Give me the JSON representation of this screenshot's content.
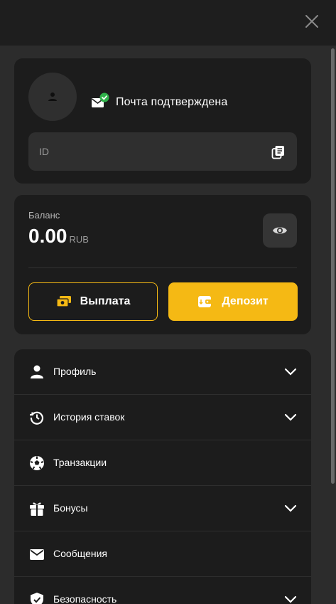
{
  "header": {
    "close_icon": "close-icon"
  },
  "profile": {
    "avatar_icon": "user-icon",
    "email_status_icon": "mail-verified-icon",
    "email_status_text": "Почта подтверждена",
    "id_label": "ID",
    "copy_icon": "copy-icon"
  },
  "balance": {
    "label": "Баланс",
    "amount": "0.00",
    "currency": "RUB",
    "visibility_icon": "eye-icon",
    "withdraw_label": "Выплата",
    "withdraw_icon": "cash-icon",
    "deposit_label": "Депозит",
    "deposit_icon": "wallet-icon"
  },
  "menu": {
    "items": [
      {
        "label": "Профиль",
        "icon": "person-icon",
        "expandable": true
      },
      {
        "label": "История ставок",
        "icon": "history-icon",
        "expandable": true
      },
      {
        "label": "Транзакции",
        "icon": "soccer-ball-icon",
        "expandable": false
      },
      {
        "label": "Бонусы",
        "icon": "gift-icon",
        "expandable": true
      },
      {
        "label": "Сообщения",
        "icon": "envelope-icon",
        "expandable": false
      },
      {
        "label": "Безопасность",
        "icon": "shield-icon",
        "expandable": true
      }
    ]
  },
  "colors": {
    "accent": "#f5b914",
    "background": "#2c2c2c",
    "card": "#1c1c1c",
    "field": "#2f2f2f",
    "verified": "#2fb24a"
  }
}
